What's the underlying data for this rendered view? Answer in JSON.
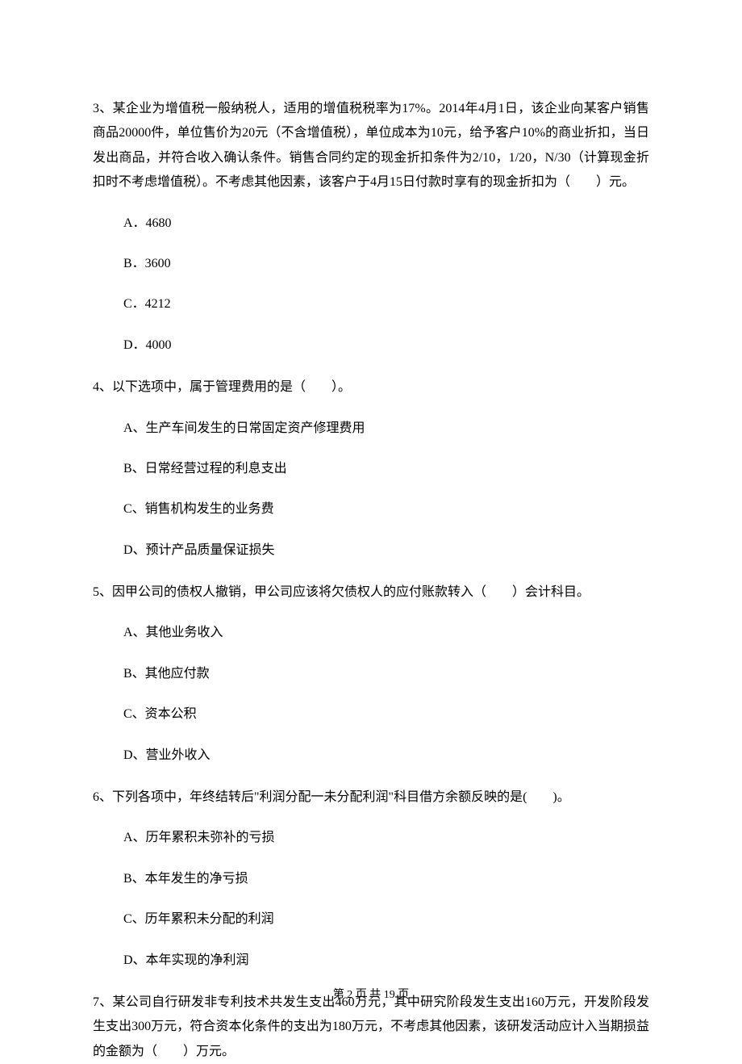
{
  "questions": [
    {
      "number": "3、",
      "text": "某企业为增值税一般纳税人，适用的增值税税率为17%。2014年4月1日，该企业向某客户销售商品20000件，单位售价为20元（不含增值税），单位成本为10元，给予客户10%的商业折扣，当日发出商品，并符合收入确认条件。销售合同约定的现金折扣条件为2/10，1/20，N/30（计算现金折扣时不考虑增值税）。不考虑其他因素，该客户于4月15日付款时享有的现金折扣为（　　）元。",
      "options": [
        "A．4680",
        "B．3600",
        "C．4212",
        "D．4000"
      ]
    },
    {
      "number": "4、",
      "text": "以下选项中，属于管理费用的是（　　）。",
      "options": [
        "A、生产车间发生的日常固定资产修理费用",
        "B、日常经营过程的利息支出",
        "C、销售机构发生的业务费",
        "D、预计产品质量保证损失"
      ]
    },
    {
      "number": "5、",
      "text": "因甲公司的债权人撤销，甲公司应该将欠债权人的应付账款转入（　　）会计科目。",
      "options": [
        "A、其他业务收入",
        "B、其他应付款",
        "C、资本公积",
        "D、营业外收入"
      ]
    },
    {
      "number": "6、",
      "text": "下列各项中，年终结转后\"利润分配一未分配利润\"科目借方余额反映的是(　　)。",
      "options": [
        "A、历年累积未弥补的亏损",
        "B、本年发生的净亏损",
        "C、历年累积未分配的利润",
        "D、本年实现的净利润"
      ]
    },
    {
      "number": "7、",
      "text": "某公司自行研发非专利技术共发生支出460万元，其中研究阶段发生支出160万元，开发阶段发生支出300万元，符合资本化条件的支出为180万元，不考虑其他因素，该研发活动应计入当期损益的金额为（　　）万元。",
      "options": []
    }
  ],
  "footer": "第 2 页 共 19 页"
}
